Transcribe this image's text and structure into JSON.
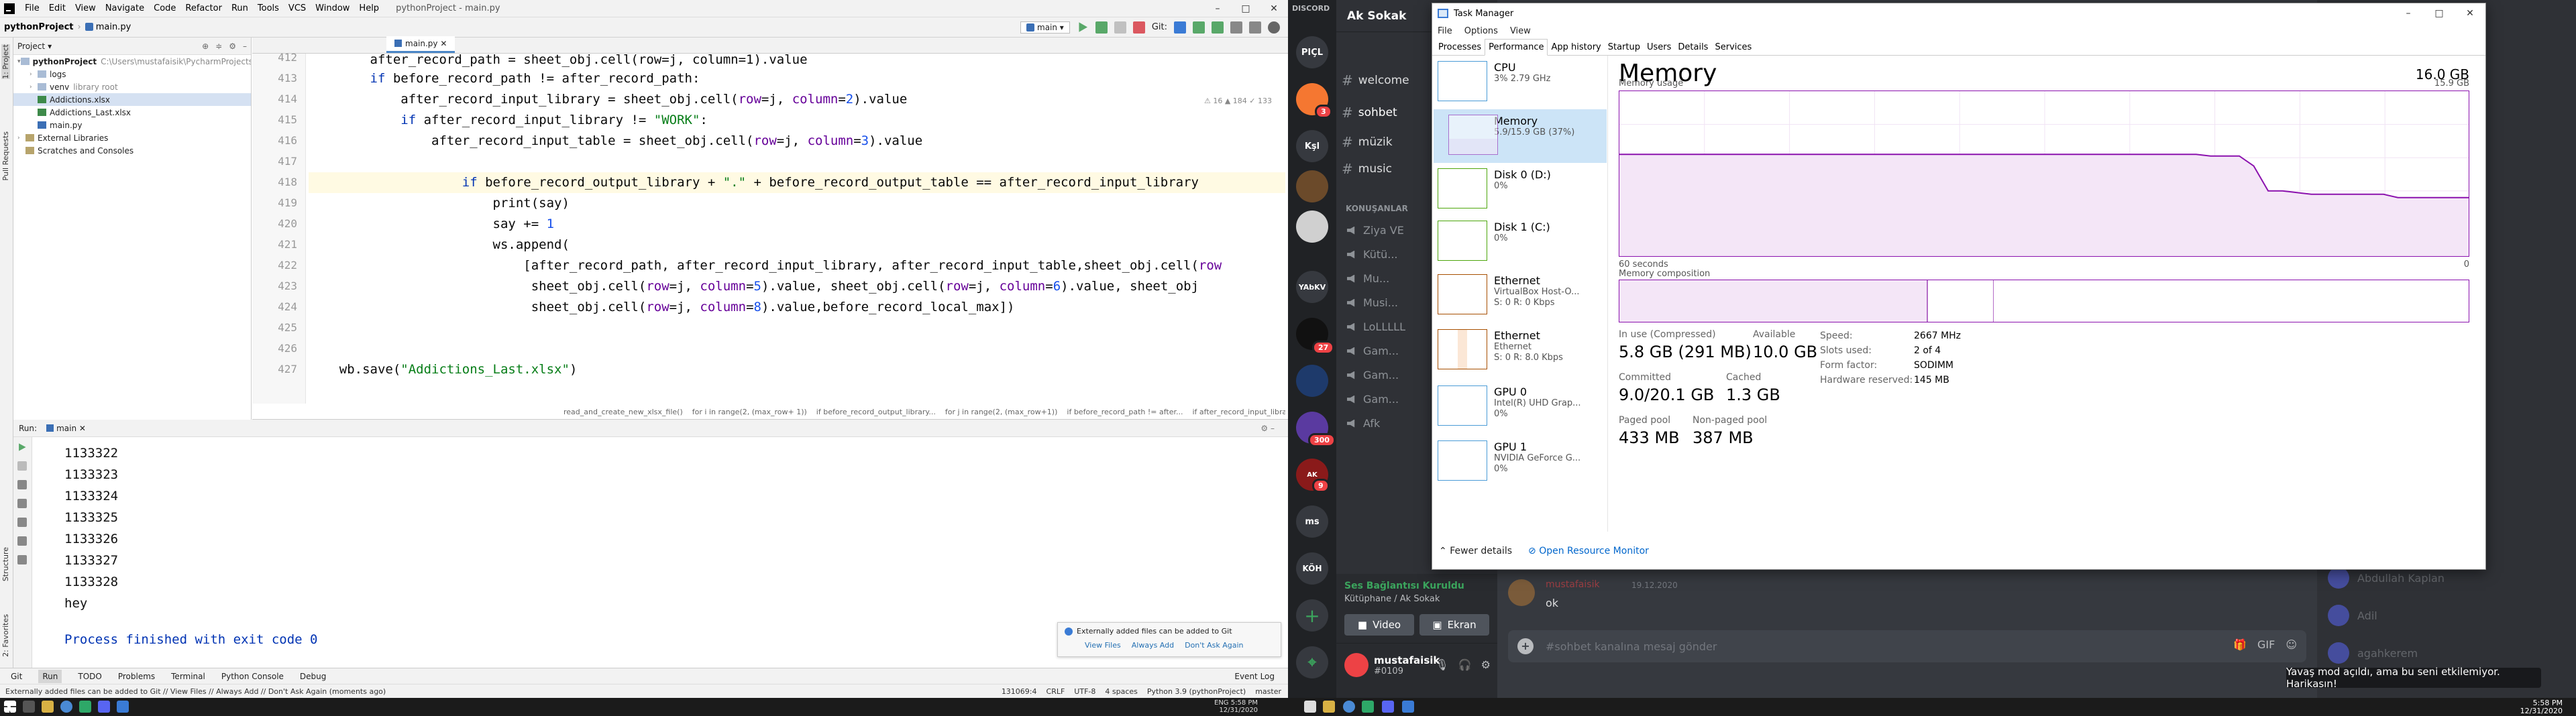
{
  "pycharm": {
    "menu": [
      "File",
      "Edit",
      "View",
      "Navigate",
      "Code",
      "Refactor",
      "Run",
      "Tools",
      "VCS",
      "Window",
      "Help"
    ],
    "title": "pythonProject - main.py",
    "nav_project": "pythonProject",
    "nav_file": "main.py",
    "run_config": "main",
    "git_label": "Git:",
    "project_header": "Project",
    "tree": [
      {
        "label": "pythonProject",
        "sub": "C:\\Users\\mustafaisik\\PycharmProjects\\pyt",
        "icon": "folder"
      },
      {
        "label": "logs",
        "sub": "",
        "icon": "folder"
      },
      {
        "label": "venv",
        "sub": "library root",
        "icon": "folder"
      },
      {
        "label": "Addictions.xlsx",
        "sub": "",
        "icon": "xlsx"
      },
      {
        "label": "Addictions_Last.xlsx",
        "sub": "",
        "icon": "xlsx"
      },
      {
        "label": "main.py",
        "sub": "",
        "icon": "py"
      },
      {
        "label": "External Libraries",
        "sub": "",
        "icon": "ext"
      },
      {
        "label": "Scratches and Consoles",
        "sub": "",
        "icon": "ext"
      }
    ],
    "editor_tab": "main.py",
    "inspections": "⚠ 16   ▲ 184   ✓ 133",
    "line_numbers": [
      "412",
      "413",
      "414",
      "415",
      "416",
      "417",
      "418",
      "419",
      "420",
      "421",
      "422",
      "423",
      "424",
      "425",
      "426",
      "427"
    ],
    "breadcrumbs": [
      "read_and_create_new_xlsx_file()",
      "for i in range(2, (max_row+ 1))",
      "if before_record_output_library...",
      "for j in range(2, (max_row+1))",
      "if before_record_path != after...",
      "if after_record_input_library !...",
      "if before_record_output_library..."
    ],
    "run_tab": "main",
    "run_label": "Run:",
    "console_lines": [
      "1133322",
      "1133323",
      "1133324",
      "1133325",
      "1133326",
      "1133327",
      "1133328",
      "hey"
    ],
    "exit_line": "Process finished with exit code 0",
    "notification": {
      "text": "Externally added files can be added to Git",
      "actions": [
        "View Files",
        "Always Add",
        "Don't Ask Again"
      ]
    },
    "bottom_tabs": [
      "Git",
      "Run",
      "TODO",
      "Problems",
      "Terminal",
      "Python Console",
      "Debug",
      "Event Log"
    ],
    "status_left": "Externally added files can be added to Git // View Files // Always Add // Don't Ask Again (moments ago)",
    "status_right": [
      "131069:4",
      "CRLF",
      "UTF-8",
      "4 spaces",
      "Python 3.9 (pythonProject)",
      "master"
    ],
    "side_labels": [
      "1: Project",
      "Pull Requests",
      "Structure",
      "2: Favorites"
    ]
  },
  "discord": {
    "brand": "DISCORD",
    "servers": [
      "PIÇL",
      "",
      "Kşl",
      "",
      "",
      "YAbKV",
      "",
      "",
      "",
      "",
      "",
      "ms",
      "KÖH"
    ],
    "badges": [
      "3",
      "27",
      "300",
      "9"
    ],
    "server_name": "Ak Sokak",
    "channels": [
      "welcome",
      "sohbet",
      "müzik",
      "music"
    ],
    "category": "KONUŞANLAR",
    "voice_channels": [
      "Ziya VE",
      "Kütü...",
      "Mu...",
      "Musi...",
      "LoLLLLL",
      "Gam...",
      "Gam...",
      "Gam...",
      "Afk"
    ],
    "voice_status": "Ses Bağlantısı Kuruldu",
    "voice_sub": "Kütüphane / Ak Sokak",
    "video_btn": "Video",
    "screen_btn": "Ekran",
    "username": "mustafaisik",
    "usertag": "#0109",
    "message_author": "mustafaisik",
    "message_date": "19.12.2020",
    "message_text": "ok",
    "input_placeholder": "#sohbet kanalına mesaj gönder",
    "members": [
      "Abdullah Kaplan",
      "Adil",
      "agahkerem"
    ],
    "toast": "Yavaş mod açıldı, ama bu seni etkilemiyor. Harikasın!"
  },
  "taskmanager": {
    "title": "Task Manager",
    "menu": [
      "File",
      "Options",
      "View"
    ],
    "tabs": [
      "Processes",
      "Performance",
      "App history",
      "Startup",
      "Users",
      "Details",
      "Services"
    ],
    "active_tab": "Performance",
    "left_items": [
      {
        "name": "CPU",
        "s1": "3% 2.79 GHz",
        "s2": "",
        "kind": "cpu"
      },
      {
        "name": "Memory",
        "s1": "5.9/15.9 GB (37%)",
        "s2": "",
        "kind": "mem"
      },
      {
        "name": "Disk 0 (D:)",
        "s1": "0%",
        "s2": "",
        "kind": "disk"
      },
      {
        "name": "Disk 1 (C:)",
        "s1": "0%",
        "s2": "",
        "kind": "disk"
      },
      {
        "name": "Ethernet",
        "s1": "VirtualBox Host-O...",
        "s2": "S: 0  R: 0 Kbps",
        "kind": "eth"
      },
      {
        "name": "Ethernet",
        "s1": "Ethernet",
        "s2": "S: 0  R: 8.0 Kbps",
        "kind": "eth"
      },
      {
        "name": "GPU 0",
        "s1": "Intel(R) UHD Grap...",
        "s2": "0%",
        "kind": "cpu"
      },
      {
        "name": "GPU 1",
        "s1": "NVIDIA GeForce G...",
        "s2": "0%",
        "kind": "cpu"
      }
    ],
    "heading": "Memory",
    "total": "16.0 GB",
    "usage_label": "Memory usage",
    "usage_max": "15.9 GB",
    "time_left": "60 seconds",
    "time_right": "0",
    "composition_label": "Memory composition",
    "stats": {
      "in_use_label": "In use (Compressed)",
      "in_use": "5.8 GB (291 MB)",
      "available_label": "Available",
      "available": "10.0 GB",
      "committed_label": "Committed",
      "committed": "9.0/20.1 GB",
      "cached_label": "Cached",
      "cached": "1.3 GB",
      "paged_label": "Paged pool",
      "paged": "433 MB",
      "nonpaged_label": "Non-paged pool",
      "nonpaged": "387 MB"
    },
    "hw": [
      {
        "k": "Speed:",
        "v": "2667 MHz"
      },
      {
        "k": "Slots used:",
        "v": "2 of 4"
      },
      {
        "k": "Form factor:",
        "v": "SODIMM"
      },
      {
        "k": "Hardware reserved:",
        "v": "145 MB"
      }
    ],
    "fewer_details": "Fewer details",
    "open_monitor": "Open Resource Monitor",
    "usage_series": [
      0.62,
      0.62,
      0.62,
      0.62,
      0.62,
      0.62,
      0.62,
      0.62,
      0.62,
      0.62,
      0.62,
      0.62,
      0.62,
      0.62,
      0.62,
      0.62,
      0.62,
      0.62,
      0.62,
      0.62,
      0.62,
      0.62,
      0.62,
      0.62,
      0.62,
      0.62,
      0.62,
      0.62,
      0.62,
      0.62,
      0.62,
      0.62,
      0.62,
      0.62,
      0.62,
      0.62,
      0.62,
      0.62,
      0.62,
      0.62,
      0.62,
      0.61,
      0.61,
      0.61,
      0.55,
      0.4,
      0.4,
      0.39,
      0.38,
      0.38,
      0.38,
      0.38,
      0.38,
      0.38,
      0.36,
      0.36,
      0.36,
      0.36,
      0.36,
      0.36
    ]
  },
  "taskbar": {
    "time": "5:58 PM",
    "date": "12/31/2020",
    "lang": "ENG"
  }
}
